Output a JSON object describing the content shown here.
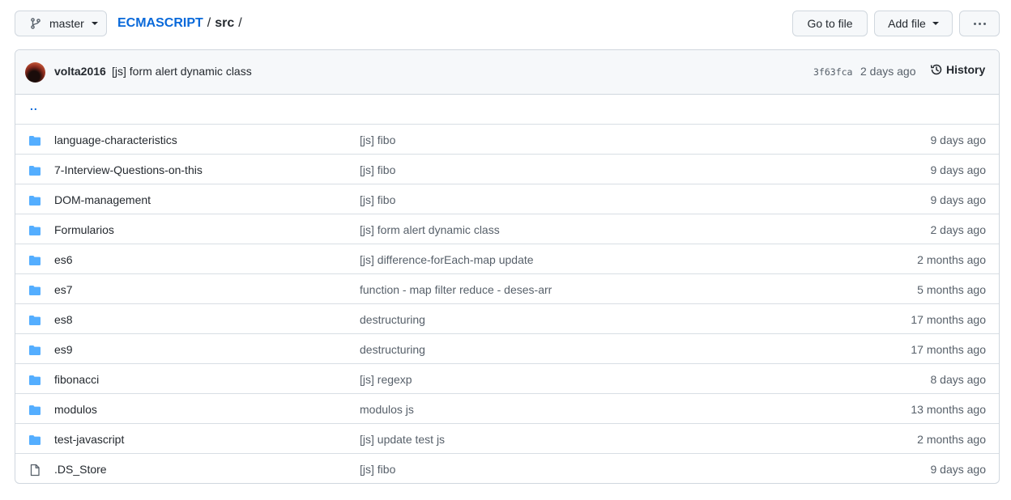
{
  "toolbar": {
    "branch": "master",
    "repo": "ECMASCRIPT",
    "separator": "/",
    "dir": "src",
    "trailing_sep": "/",
    "go_to_file": "Go to file",
    "add_file": "Add file"
  },
  "commit": {
    "author": "volta2016",
    "message": "[js] form alert dynamic class",
    "sha": "3f63fca",
    "time": "2 days ago",
    "history_label": "History"
  },
  "parent_link": "..",
  "files": [
    {
      "type": "folder",
      "name": "language-characteristics",
      "message": "[js] fibo",
      "time": "9 days ago"
    },
    {
      "type": "folder",
      "name": "7-Interview-Questions-on-this",
      "message": "[js] fibo",
      "time": "9 days ago"
    },
    {
      "type": "folder",
      "name": "DOM-management",
      "message": "[js] fibo",
      "time": "9 days ago"
    },
    {
      "type": "folder",
      "name": "Formularios",
      "message": "[js] form alert dynamic class",
      "time": "2 days ago"
    },
    {
      "type": "folder",
      "name": "es6",
      "message": "[js] difference-forEach-map update",
      "time": "2 months ago"
    },
    {
      "type": "folder",
      "name": "es7",
      "message": "function - map filter reduce - deses-arr",
      "time": "5 months ago"
    },
    {
      "type": "folder",
      "name": "es8",
      "message": "destructuring",
      "time": "17 months ago"
    },
    {
      "type": "folder",
      "name": "es9",
      "message": "destructuring",
      "time": "17 months ago"
    },
    {
      "type": "folder",
      "name": "fibonacci",
      "message": "[js] regexp",
      "time": "8 days ago"
    },
    {
      "type": "folder",
      "name": "modulos",
      "message": "modulos js",
      "time": "13 months ago"
    },
    {
      "type": "folder",
      "name": "test-javascript",
      "message": "[js] update test js",
      "time": "2 months ago"
    },
    {
      "type": "file",
      "name": ".DS_Store",
      "message": "[js] fibo",
      "time": "9 days ago"
    }
  ],
  "colors": {
    "folder_icon": "#54aeff",
    "file_icon": "#57606a",
    "link": "#0969da"
  }
}
